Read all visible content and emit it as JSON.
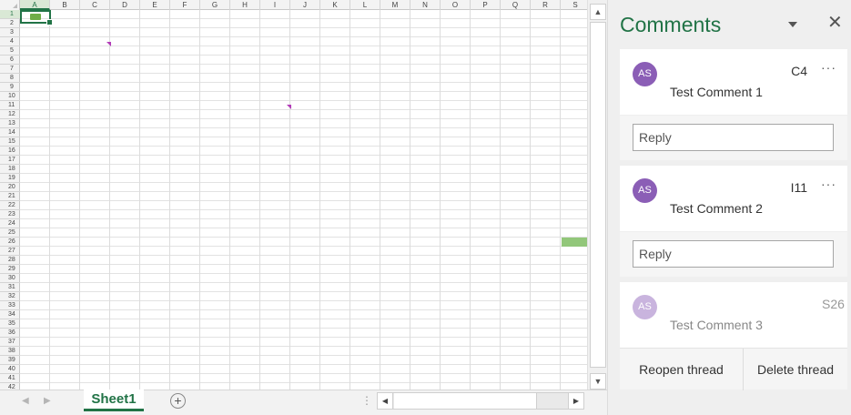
{
  "sheet": {
    "columns": [
      "A",
      "B",
      "C",
      "D",
      "E",
      "F",
      "G",
      "H",
      "I",
      "J",
      "K",
      "L",
      "M",
      "N",
      "O",
      "P",
      "Q",
      "R",
      "S"
    ],
    "rows": [
      "1",
      "2",
      "3",
      "4",
      "5",
      "6",
      "7",
      "8",
      "9",
      "10",
      "11",
      "12",
      "13",
      "14",
      "15",
      "16",
      "17",
      "18",
      "19",
      "20",
      "21",
      "22",
      "23",
      "24",
      "25",
      "26",
      "27",
      "28",
      "29",
      "30",
      "31",
      "32",
      "33",
      "34",
      "35",
      "36",
      "37",
      "38",
      "39",
      "40",
      "41",
      "42"
    ],
    "active_cell": "A1",
    "highlight_color": "#92c77a",
    "comment_indicator_color": "#b23cb8"
  },
  "scrollbar": {
    "up_glyph": "▲",
    "down_glyph": "▼",
    "left_glyph": "◀",
    "right_glyph": "▶"
  },
  "tabs": {
    "sheet_name": "Sheet1",
    "add_glyph": "+",
    "prev_glyph": "◀",
    "next_glyph": "▶",
    "separator": "⋮"
  },
  "pane": {
    "title": "Comments",
    "close_glyph": "✕",
    "accent_color": "#217346",
    "threads": [
      {
        "initials": "AS",
        "cell": "C4",
        "text": "Test Comment 1",
        "more": "···",
        "reply_placeholder": "Reply"
      },
      {
        "initials": "AS",
        "cell": "I11",
        "text": "Test Comment 2",
        "more": "···",
        "reply_placeholder": "Reply"
      },
      {
        "initials": "AS",
        "cell": "S26",
        "text": "Test Comment 3",
        "resolved": true
      }
    ],
    "reopen_label": "Reopen thread",
    "delete_label": "Delete thread"
  }
}
